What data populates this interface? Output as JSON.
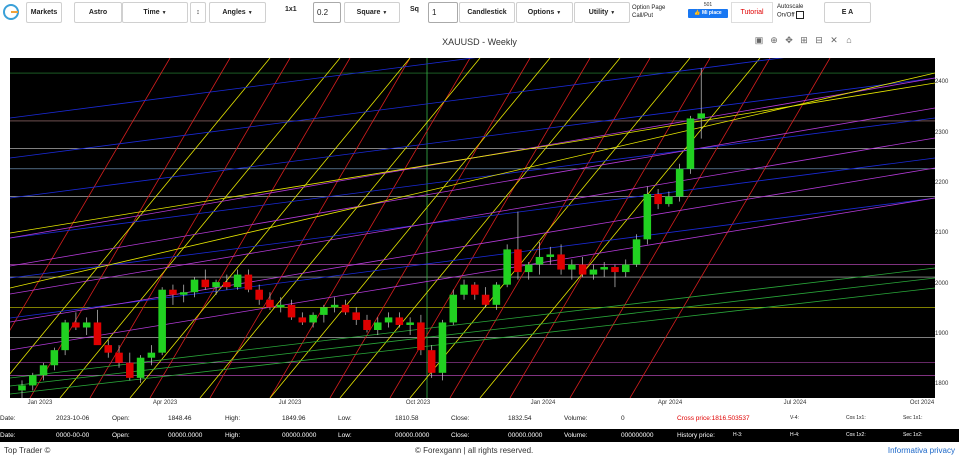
{
  "toolbar": {
    "markets": "Markets",
    "astro": "Astro",
    "time": "Time",
    "angles": "Angles",
    "ratio_label": "1x1",
    "ratio_value": "0.2",
    "square": "Square",
    "sq_label": "Sq",
    "sq_value": "1",
    "candlestick": "Candlestick",
    "options": "Options",
    "utility": "Utility",
    "option_page_line1": "Option Page",
    "option_page_line2": "Call/Put",
    "fb_count": "501",
    "fb_like": "Mi piace",
    "tutorial": "Tutorial",
    "autoscale_line1": "Autoscale",
    "autoscale_line2": "On/Off",
    "ea": "E A"
  },
  "chart": {
    "title": "XAUUSD - Weekly",
    "y_ticks": [
      "2400",
      "2300",
      "2200",
      "2100",
      "2000",
      "1900",
      "1800"
    ],
    "x_ticks": [
      "Jan 2023",
      "Apr 2023",
      "Jul 2023",
      "Oct 2023",
      "Jan 2024",
      "Apr 2024",
      "Jul 2024",
      "Oct 2024"
    ]
  },
  "chart_data": {
    "type": "candlestick",
    "title": "XAUUSD - Weekly",
    "xlabel": "",
    "ylabel": "",
    "ylim": [
      1775,
      2450
    ],
    "x_ticks": [
      "Jan 2023",
      "Apr 2023",
      "Jul 2023",
      "Oct 2023",
      "Jan 2024",
      "Apr 2024",
      "Jul 2024",
      "Oct 2024"
    ],
    "grid": false,
    "candles": [
      {
        "o": 1790,
        "h": 1810,
        "l": 1775,
        "c": 1800
      },
      {
        "o": 1800,
        "h": 1825,
        "l": 1790,
        "c": 1820
      },
      {
        "o": 1820,
        "h": 1845,
        "l": 1810,
        "c": 1840
      },
      {
        "o": 1840,
        "h": 1875,
        "l": 1830,
        "c": 1870
      },
      {
        "o": 1870,
        "h": 1930,
        "l": 1860,
        "c": 1925
      },
      {
        "o": 1925,
        "h": 1945,
        "l": 1910,
        "c": 1915
      },
      {
        "o": 1915,
        "h": 1935,
        "l": 1900,
        "c": 1925
      },
      {
        "o": 1925,
        "h": 1950,
        "l": 1900,
        "c": 1880
      },
      {
        "o": 1880,
        "h": 1890,
        "l": 1855,
        "c": 1865
      },
      {
        "o": 1865,
        "h": 1880,
        "l": 1835,
        "c": 1845
      },
      {
        "o": 1845,
        "h": 1865,
        "l": 1810,
        "c": 1815
      },
      {
        "o": 1815,
        "h": 1860,
        "l": 1805,
        "c": 1855
      },
      {
        "o": 1855,
        "h": 1880,
        "l": 1840,
        "c": 1865
      },
      {
        "o": 1865,
        "h": 1995,
        "l": 1860,
        "c": 1990
      },
      {
        "o": 1990,
        "h": 2000,
        "l": 1960,
        "c": 1980
      },
      {
        "o": 1980,
        "h": 2000,
        "l": 1965,
        "c": 1985
      },
      {
        "o": 1985,
        "h": 2015,
        "l": 1975,
        "c": 2010
      },
      {
        "o": 2010,
        "h": 2030,
        "l": 1990,
        "c": 1995
      },
      {
        "o": 1995,
        "h": 2010,
        "l": 1980,
        "c": 2005
      },
      {
        "o": 2005,
        "h": 2020,
        "l": 1990,
        "c": 1995
      },
      {
        "o": 1995,
        "h": 2030,
        "l": 1990,
        "c": 2020
      },
      {
        "o": 2020,
        "h": 2030,
        "l": 1985,
        "c": 1990
      },
      {
        "o": 1990,
        "h": 2000,
        "l": 1960,
        "c": 1970
      },
      {
        "o": 1970,
        "h": 1985,
        "l": 1950,
        "c": 1955
      },
      {
        "o": 1955,
        "h": 1975,
        "l": 1945,
        "c": 1960
      },
      {
        "o": 1960,
        "h": 1970,
        "l": 1930,
        "c": 1935
      },
      {
        "o": 1935,
        "h": 1945,
        "l": 1920,
        "c": 1925
      },
      {
        "o": 1925,
        "h": 1945,
        "l": 1915,
        "c": 1940
      },
      {
        "o": 1940,
        "h": 1960,
        "l": 1925,
        "c": 1955
      },
      {
        "o": 1955,
        "h": 1975,
        "l": 1945,
        "c": 1960
      },
      {
        "o": 1960,
        "h": 1970,
        "l": 1940,
        "c": 1945
      },
      {
        "o": 1945,
        "h": 1955,
        "l": 1920,
        "c": 1930
      },
      {
        "o": 1930,
        "h": 1940,
        "l": 1905,
        "c": 1910
      },
      {
        "o": 1910,
        "h": 1935,
        "l": 1900,
        "c": 1925
      },
      {
        "o": 1925,
        "h": 1945,
        "l": 1915,
        "c": 1935
      },
      {
        "o": 1935,
        "h": 1945,
        "l": 1915,
        "c": 1920
      },
      {
        "o": 1920,
        "h": 1935,
        "l": 1900,
        "c": 1925
      },
      {
        "o": 1925,
        "h": 1940,
        "l": 1860,
        "c": 1870
      },
      {
        "o": 1870,
        "h": 1880,
        "l": 1815,
        "c": 1825
      },
      {
        "o": 1825,
        "h": 1930,
        "l": 1810,
        "c": 1925
      },
      {
        "o": 1925,
        "h": 1990,
        "l": 1920,
        "c": 1980
      },
      {
        "o": 1980,
        "h": 2010,
        "l": 1970,
        "c": 2000
      },
      {
        "o": 2000,
        "h": 2005,
        "l": 1970,
        "c": 1980
      },
      {
        "o": 1980,
        "h": 1995,
        "l": 1955,
        "c": 1960
      },
      {
        "o": 1960,
        "h": 2005,
        "l": 1950,
        "c": 2000
      },
      {
        "o": 2000,
        "h": 2080,
        "l": 1995,
        "c": 2070
      },
      {
        "o": 2070,
        "h": 2145,
        "l": 2010,
        "c": 2025
      },
      {
        "o": 2025,
        "h": 2045,
        "l": 2010,
        "c": 2040
      },
      {
        "o": 2040,
        "h": 2085,
        "l": 2020,
        "c": 2055
      },
      {
        "o": 2055,
        "h": 2075,
        "l": 2040,
        "c": 2060
      },
      {
        "o": 2060,
        "h": 2080,
        "l": 2020,
        "c": 2030
      },
      {
        "o": 2030,
        "h": 2050,
        "l": 2010,
        "c": 2040
      },
      {
        "o": 2040,
        "h": 2055,
        "l": 2015,
        "c": 2020
      },
      {
        "o": 2020,
        "h": 2040,
        "l": 2010,
        "c": 2030
      },
      {
        "o": 2030,
        "h": 2045,
        "l": 2015,
        "c": 2035
      },
      {
        "o": 2035,
        "h": 2040,
        "l": 1995,
        "c": 2025
      },
      {
        "o": 2025,
        "h": 2050,
        "l": 2015,
        "c": 2040
      },
      {
        "o": 2040,
        "h": 2100,
        "l": 2035,
        "c": 2090
      },
      {
        "o": 2090,
        "h": 2195,
        "l": 2080,
        "c": 2180
      },
      {
        "o": 2180,
        "h": 2190,
        "l": 2150,
        "c": 2160
      },
      {
        "o": 2160,
        "h": 2185,
        "l": 2155,
        "c": 2175
      },
      {
        "o": 2175,
        "h": 2240,
        "l": 2165,
        "c": 2230
      },
      {
        "o": 2230,
        "h": 2335,
        "l": 2220,
        "c": 2330
      },
      {
        "o": 2330,
        "h": 2430,
        "l": 2290,
        "c": 2340
      }
    ],
    "bull_color": "#21d121",
    "bear_color": "#e00000",
    "horizontal_levels": [
      2420,
      2325,
      2270,
      2230,
      2175,
      2040,
      2015,
      1955,
      1895,
      1845,
      1820
    ],
    "horizontal_colors": [
      "#39b54a",
      "#e0a0a0",
      "#ffffff",
      "#9ad0ff",
      "#ffffff",
      "#ff66ff",
      "#ffffff",
      "#ffff00",
      "#ffffff",
      "#ff66ff",
      "#ff66ff"
    ]
  },
  "info_row1": {
    "date_label": "Date:",
    "date": "2023-10-06",
    "open_label": "Open:",
    "open": "1848.46",
    "high_label": "High:",
    "high": "1849.96",
    "low_label": "Low:",
    "low": "1810.58",
    "close_label": "Close:",
    "close": "1832.54",
    "volume_label": "Volume:",
    "volume": "0",
    "cross_price": "Cross price:1816.503537",
    "v4": "V-4:",
    "cos1": "Cos 1x1:",
    "sec1": "Sec 1x1:"
  },
  "info_row2": {
    "date_label": "Date:",
    "date": "0000-00-00",
    "open_label": "Open:",
    "open": "00000.0000",
    "high_label": "High:",
    "high": "00000.0000",
    "low_label": "Low:",
    "low": "00000.0000",
    "close_label": "Close:",
    "close": "00000.0000",
    "volume_label": "Volume:",
    "volume": "000000000",
    "history_price": "History price:",
    "h3": "H-3:",
    "h4": "H-4:",
    "cos2": "Cos 1x2:",
    "sec2": "Sec 1x2:"
  },
  "footer": {
    "left": "Top Trader ©",
    "middle": "© Forexgann | all rights reserved.",
    "right": "Informativa privacy"
  }
}
